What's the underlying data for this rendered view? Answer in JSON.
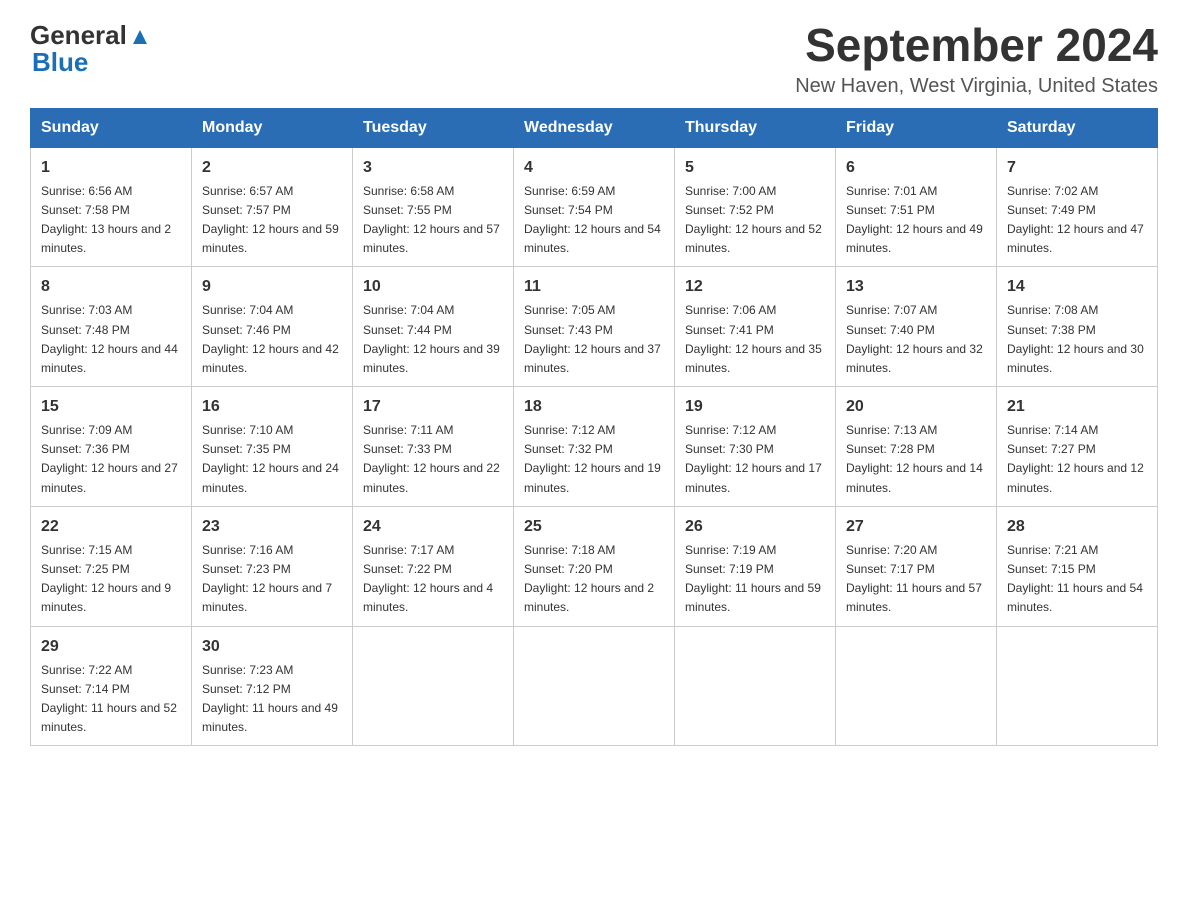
{
  "header": {
    "logo_general": "General",
    "logo_blue": "Blue",
    "month_title": "September 2024",
    "location": "New Haven, West Virginia, United States"
  },
  "weekdays": [
    "Sunday",
    "Monday",
    "Tuesday",
    "Wednesday",
    "Thursday",
    "Friday",
    "Saturday"
  ],
  "weeks": [
    [
      {
        "day": "1",
        "sunrise": "6:56 AM",
        "sunset": "7:58 PM",
        "daylight": "13 hours and 2 minutes."
      },
      {
        "day": "2",
        "sunrise": "6:57 AM",
        "sunset": "7:57 PM",
        "daylight": "12 hours and 59 minutes."
      },
      {
        "day": "3",
        "sunrise": "6:58 AM",
        "sunset": "7:55 PM",
        "daylight": "12 hours and 57 minutes."
      },
      {
        "day": "4",
        "sunrise": "6:59 AM",
        "sunset": "7:54 PM",
        "daylight": "12 hours and 54 minutes."
      },
      {
        "day": "5",
        "sunrise": "7:00 AM",
        "sunset": "7:52 PM",
        "daylight": "12 hours and 52 minutes."
      },
      {
        "day": "6",
        "sunrise": "7:01 AM",
        "sunset": "7:51 PM",
        "daylight": "12 hours and 49 minutes."
      },
      {
        "day": "7",
        "sunrise": "7:02 AM",
        "sunset": "7:49 PM",
        "daylight": "12 hours and 47 minutes."
      }
    ],
    [
      {
        "day": "8",
        "sunrise": "7:03 AM",
        "sunset": "7:48 PM",
        "daylight": "12 hours and 44 minutes."
      },
      {
        "day": "9",
        "sunrise": "7:04 AM",
        "sunset": "7:46 PM",
        "daylight": "12 hours and 42 minutes."
      },
      {
        "day": "10",
        "sunrise": "7:04 AM",
        "sunset": "7:44 PM",
        "daylight": "12 hours and 39 minutes."
      },
      {
        "day": "11",
        "sunrise": "7:05 AM",
        "sunset": "7:43 PM",
        "daylight": "12 hours and 37 minutes."
      },
      {
        "day": "12",
        "sunrise": "7:06 AM",
        "sunset": "7:41 PM",
        "daylight": "12 hours and 35 minutes."
      },
      {
        "day": "13",
        "sunrise": "7:07 AM",
        "sunset": "7:40 PM",
        "daylight": "12 hours and 32 minutes."
      },
      {
        "day": "14",
        "sunrise": "7:08 AM",
        "sunset": "7:38 PM",
        "daylight": "12 hours and 30 minutes."
      }
    ],
    [
      {
        "day": "15",
        "sunrise": "7:09 AM",
        "sunset": "7:36 PM",
        "daylight": "12 hours and 27 minutes."
      },
      {
        "day": "16",
        "sunrise": "7:10 AM",
        "sunset": "7:35 PM",
        "daylight": "12 hours and 24 minutes."
      },
      {
        "day": "17",
        "sunrise": "7:11 AM",
        "sunset": "7:33 PM",
        "daylight": "12 hours and 22 minutes."
      },
      {
        "day": "18",
        "sunrise": "7:12 AM",
        "sunset": "7:32 PM",
        "daylight": "12 hours and 19 minutes."
      },
      {
        "day": "19",
        "sunrise": "7:12 AM",
        "sunset": "7:30 PM",
        "daylight": "12 hours and 17 minutes."
      },
      {
        "day": "20",
        "sunrise": "7:13 AM",
        "sunset": "7:28 PM",
        "daylight": "12 hours and 14 minutes."
      },
      {
        "day": "21",
        "sunrise": "7:14 AM",
        "sunset": "7:27 PM",
        "daylight": "12 hours and 12 minutes."
      }
    ],
    [
      {
        "day": "22",
        "sunrise": "7:15 AM",
        "sunset": "7:25 PM",
        "daylight": "12 hours and 9 minutes."
      },
      {
        "day": "23",
        "sunrise": "7:16 AM",
        "sunset": "7:23 PM",
        "daylight": "12 hours and 7 minutes."
      },
      {
        "day": "24",
        "sunrise": "7:17 AM",
        "sunset": "7:22 PM",
        "daylight": "12 hours and 4 minutes."
      },
      {
        "day": "25",
        "sunrise": "7:18 AM",
        "sunset": "7:20 PM",
        "daylight": "12 hours and 2 minutes."
      },
      {
        "day": "26",
        "sunrise": "7:19 AM",
        "sunset": "7:19 PM",
        "daylight": "11 hours and 59 minutes."
      },
      {
        "day": "27",
        "sunrise": "7:20 AM",
        "sunset": "7:17 PM",
        "daylight": "11 hours and 57 minutes."
      },
      {
        "day": "28",
        "sunrise": "7:21 AM",
        "sunset": "7:15 PM",
        "daylight": "11 hours and 54 minutes."
      }
    ],
    [
      {
        "day": "29",
        "sunrise": "7:22 AM",
        "sunset": "7:14 PM",
        "daylight": "11 hours and 52 minutes."
      },
      {
        "day": "30",
        "sunrise": "7:23 AM",
        "sunset": "7:12 PM",
        "daylight": "11 hours and 49 minutes."
      },
      null,
      null,
      null,
      null,
      null
    ]
  ],
  "labels": {
    "sunrise": "Sunrise:",
    "sunset": "Sunset:",
    "daylight": "Daylight:"
  }
}
